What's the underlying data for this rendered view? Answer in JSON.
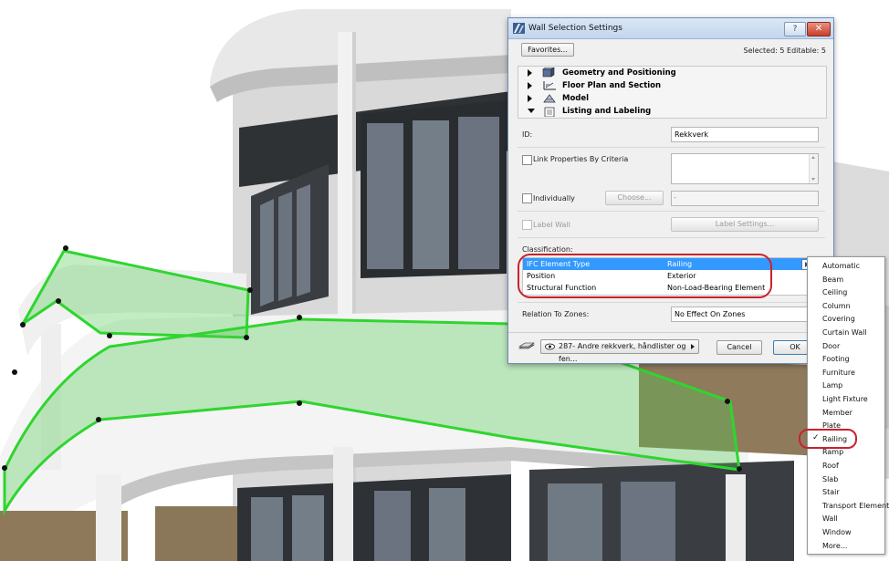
{
  "dialog": {
    "title": "Wall Selection Settings",
    "help_label": "?",
    "close_label": "✕",
    "favorites_label": "Favorites...",
    "selection_status": "Selected: 5 Editable: 5"
  },
  "sections": [
    {
      "label": "Geometry and Positioning",
      "expanded": false
    },
    {
      "label": "Floor Plan and Section",
      "expanded": false
    },
    {
      "label": "Model",
      "expanded": false
    },
    {
      "label": "Listing and Labeling",
      "expanded": true
    }
  ],
  "listing": {
    "id_label": "ID:",
    "id_value": "Rekkverk",
    "link_props_label": "Link Properties By Criteria",
    "individually_label": "Individually",
    "choose_label": "Choose...",
    "individually_field_value": "-",
    "label_wall_label": "Label Wall",
    "label_settings_label": "Label Settings...",
    "classification_label": "Classification:",
    "classification_rows": [
      {
        "key": "IFC Element Type",
        "value": "Railing"
      },
      {
        "key": "Position",
        "value": "Exterior"
      },
      {
        "key": "Structural Function",
        "value": "Non-Load-Bearing Element"
      }
    ],
    "relation_label": "Relation To Zones:",
    "relation_value": "No Effect On Zones"
  },
  "footer": {
    "layer_value": "287- Andre rekkverk, håndlister og fen...",
    "cancel_label": "Cancel",
    "ok_label": "OK"
  },
  "ifc_menu": {
    "items": [
      "Automatic",
      "Beam",
      "Ceiling",
      "Column",
      "Covering",
      "Curtain Wall",
      "Door",
      "Footing",
      "Furniture",
      "Lamp",
      "Light Fixture",
      "Member",
      "Plate",
      "Railing",
      "Ramp",
      "Roof",
      "Slab",
      "Stair",
      "Transport Element",
      "Wall",
      "Window",
      "More..."
    ],
    "checked_item": "Railing",
    "check_mark": "✓"
  },
  "colors": {
    "selection_highlight": "#3399ff",
    "railing_outline": "#2fd52f",
    "annotation_oval": "#c8232c"
  }
}
